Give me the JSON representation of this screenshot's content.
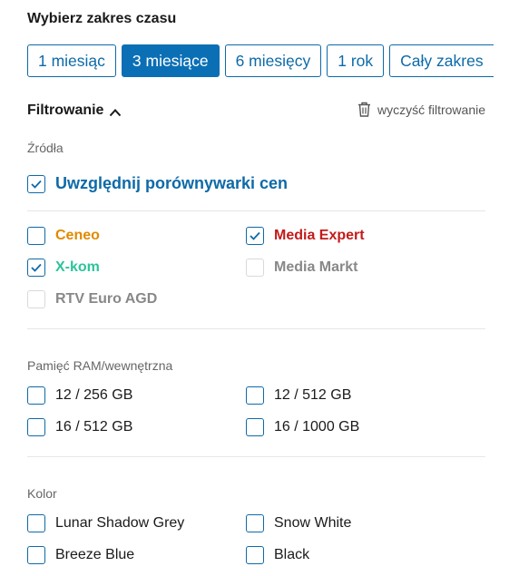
{
  "time_range": {
    "title": "Wybierz zakres czasu",
    "options": [
      "1 miesiąc",
      "3 miesiące",
      "6 miesięcy",
      "1 rok",
      "Cały zakres"
    ],
    "selected": "3 miesiące"
  },
  "filter": {
    "title": "Filtrowanie",
    "clear_label": "wyczyść filtrowanie"
  },
  "sources": {
    "label": "Źródła",
    "include_comparators": {
      "label": "Uwzględnij porównywarki cen",
      "checked": true,
      "color": "#0d6aa8"
    },
    "items": [
      {
        "label": "Ceneo",
        "checked": false,
        "color": "#e08a00"
      },
      {
        "label": "Media Expert",
        "checked": true,
        "color": "#c41a1a"
      },
      {
        "label": "X-kom",
        "checked": true,
        "color": "#2cc49a"
      },
      {
        "label": "Media Markt",
        "checked": false,
        "disabled": true,
        "color": "#888888"
      },
      {
        "label": "RTV Euro AGD",
        "checked": false,
        "disabled": true,
        "color": "#888888"
      }
    ]
  },
  "memory": {
    "label": "Pamięć RAM/wewnętrzna",
    "items": [
      {
        "label": "12 / 256 GB",
        "checked": false
      },
      {
        "label": "12 / 512 GB",
        "checked": false
      },
      {
        "label": "16 / 512 GB",
        "checked": false
      },
      {
        "label": "16 / 1000 GB",
        "checked": false
      }
    ]
  },
  "color": {
    "label": "Kolor",
    "items": [
      {
        "label": "Lunar Shadow Grey",
        "checked": false
      },
      {
        "label": "Snow White",
        "checked": false
      },
      {
        "label": "Breeze Blue",
        "checked": false
      },
      {
        "label": "Black",
        "checked": false
      }
    ]
  },
  "accent_color": "#0b6fb5"
}
